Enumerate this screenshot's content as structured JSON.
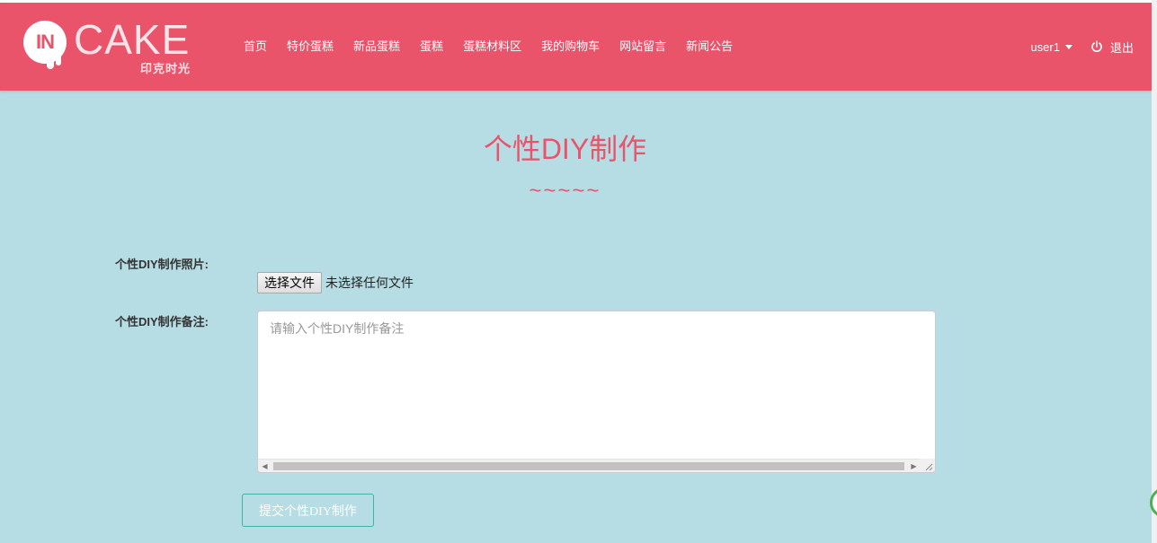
{
  "brand": {
    "logo_in": "IN",
    "logo_cake": "CAKE",
    "logo_sub": "印克时光"
  },
  "nav": {
    "items": [
      {
        "label": "首页"
      },
      {
        "label": "特价蛋糕"
      },
      {
        "label": "新品蛋糕"
      },
      {
        "label": "蛋糕"
      },
      {
        "label": "蛋糕材料区"
      },
      {
        "label": "我的购物车"
      },
      {
        "label": "网站留言"
      },
      {
        "label": "新闻公告"
      }
    ],
    "user": "user1",
    "logout": "退出"
  },
  "page": {
    "title": "个性DIY制作",
    "decoration": "~~~~~"
  },
  "form": {
    "photo_label": "个性DIY制作照片:",
    "file_button": "选择文件",
    "file_status": "未选择任何文件",
    "note_label": "个性DIY制作备注:",
    "note_placeholder": "请输入个性DIY制作备注",
    "submit_label": "提交个性DIY制作"
  },
  "colors": {
    "navbar": "#e9546b",
    "background": "#b6dce4",
    "accent": "#e9546b",
    "submit_border": "#3fb3a5"
  }
}
